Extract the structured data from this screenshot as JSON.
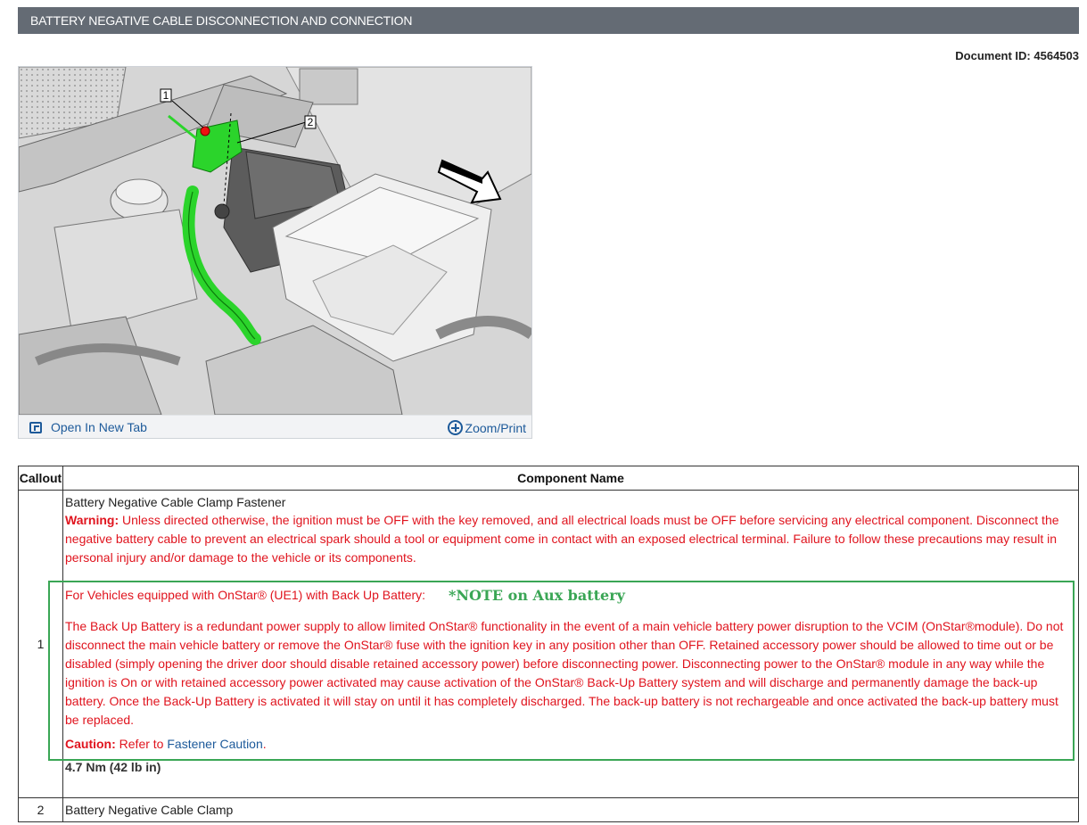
{
  "header": {
    "title": "BATTERY NEGATIVE CABLE DISCONNECTION AND CONNECTION",
    "document_id": "Document ID: 4564503"
  },
  "figure": {
    "callout_labels": [
      "1",
      "2"
    ],
    "open_new_tab_label": "Open In New Tab",
    "zoom_print_label": "Zoom/Print",
    "icons": [
      "open-new-tab-icon",
      "zoom-plus-icon"
    ],
    "highlight_color": "#2bd42b",
    "annotation_color": "#3aa655"
  },
  "table": {
    "headers": {
      "callout": "Callout",
      "component": "Component Name"
    },
    "rows": [
      {
        "callout": "1",
        "component": "Battery Negative Cable Clamp Fastener",
        "warning_label": "Warning:",
        "warning_text": " Unless directed otherwise, the ignition must be OFF with the key removed, and all electrical loads must be OFF before servicing any electrical component. Disconnect the negative battery cable to prevent an electrical spark should a tool or equipment come in contact with an exposed electrical terminal. Failure to follow these precautions may result in personal injury and/or damage to the vehicle or its components.",
        "onstar_heading": "For Vehicles equipped with OnStar® (UE1) with Back Up Battery:",
        "note": "*NOTE on Aux battery",
        "onstar_text": "The Back Up Battery is a redundant power supply to allow limited OnStar® functionality in the event of a main vehicle battery power disruption to the VCIM (OnStar®module). Do not disconnect the main vehicle battery or remove the OnStar® fuse with the ignition key in any position other than OFF. Retained accessory power should be allowed to time out or be disabled (simply opening the driver door should disable retained accessory power) before disconnecting power. Disconnecting power to the OnStar® module in any way while the ignition is On or with retained accessory power activated may cause activation of the OnStar® Back-Up Battery system and will discharge and permanently damage the back-up battery. Once the Back-Up Battery is activated it will stay on until it has completely discharged. The back-up battery is not rechargeable and once activated the back-up battery must be replaced.",
        "caution_label": "Caution:",
        "caution_prefix": " Refer to ",
        "caution_link": "Fastener Caution",
        "caution_suffix": ".",
        "torque": "4.7 Nm (42 lb in)"
      },
      {
        "callout": "2",
        "component": "Battery Negative Cable Clamp"
      }
    ]
  }
}
